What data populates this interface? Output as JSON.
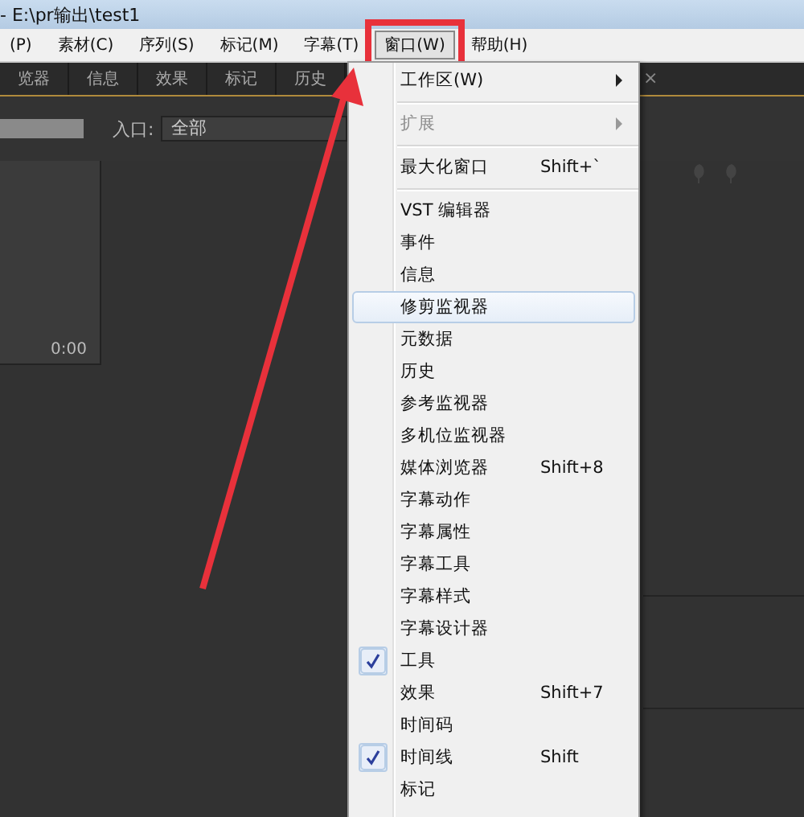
{
  "window": {
    "title": "- E:\\pr输出\\test1"
  },
  "menubar": [
    {
      "label": "(P)",
      "selected": false
    },
    {
      "label": "素材(C)",
      "selected": false
    },
    {
      "label": "序列(S)",
      "selected": false
    },
    {
      "label": "标记(M)",
      "selected": false
    },
    {
      "label": "字幕(T)",
      "selected": false
    },
    {
      "label": "窗口(W)",
      "selected": true
    },
    {
      "label": "帮助(H)",
      "selected": false
    }
  ],
  "panel_tabs": [
    {
      "label": "览器",
      "selected": false
    },
    {
      "label": "信息",
      "selected": false
    },
    {
      "label": "效果",
      "selected": false
    },
    {
      "label": "标记",
      "selected": false
    },
    {
      "label": "历史",
      "selected": false
    }
  ],
  "close_glyph": "×",
  "in_point": {
    "label": "入口:",
    "value": "全部"
  },
  "monitor": {
    "timecode": "0:00"
  },
  "menu": [
    {
      "kind": "submenu",
      "label": "工作区(W)",
      "disabled": false,
      "checked": false,
      "selected": false
    },
    {
      "kind": "separator"
    },
    {
      "kind": "submenu",
      "label": "扩展",
      "disabled": true,
      "checked": false,
      "selected": false
    },
    {
      "kind": "separator"
    },
    {
      "kind": "item",
      "label": "最大化窗口",
      "shortcut": "Shift+`",
      "disabled": false,
      "checked": false,
      "selected": false
    },
    {
      "kind": "separator"
    },
    {
      "kind": "item",
      "label": "VST 编辑器",
      "disabled": false,
      "checked": false,
      "selected": false
    },
    {
      "kind": "item",
      "label": "事件",
      "disabled": false,
      "checked": false,
      "selected": false
    },
    {
      "kind": "item",
      "label": "信息",
      "disabled": false,
      "checked": false,
      "selected": false
    },
    {
      "kind": "item",
      "label": "修剪监视器",
      "disabled": false,
      "checked": false,
      "selected": true
    },
    {
      "kind": "item",
      "label": "元数据",
      "disabled": false,
      "checked": false,
      "selected": false
    },
    {
      "kind": "item",
      "label": "历史",
      "disabled": false,
      "checked": false,
      "selected": false
    },
    {
      "kind": "item",
      "label": "参考监视器",
      "disabled": false,
      "checked": false,
      "selected": false
    },
    {
      "kind": "item",
      "label": "多机位监视器",
      "disabled": false,
      "checked": false,
      "selected": false
    },
    {
      "kind": "item",
      "label": "媒体浏览器",
      "shortcut": "Shift+8",
      "disabled": false,
      "checked": false,
      "selected": false
    },
    {
      "kind": "item",
      "label": "字幕动作",
      "disabled": false,
      "checked": false,
      "selected": false
    },
    {
      "kind": "item",
      "label": "字幕属性",
      "disabled": false,
      "checked": false,
      "selected": false
    },
    {
      "kind": "item",
      "label": "字幕工具",
      "disabled": false,
      "checked": false,
      "selected": false
    },
    {
      "kind": "item",
      "label": "字幕样式",
      "disabled": false,
      "checked": false,
      "selected": false
    },
    {
      "kind": "item",
      "label": "字幕设计器",
      "disabled": false,
      "checked": false,
      "selected": false
    },
    {
      "kind": "item",
      "label": "工具",
      "disabled": false,
      "checked": true,
      "selected": false
    },
    {
      "kind": "item",
      "label": "效果",
      "shortcut": "Shift+7",
      "disabled": false,
      "checked": false,
      "selected": false
    },
    {
      "kind": "item",
      "label": "时间码",
      "disabled": false,
      "checked": false,
      "selected": false
    },
    {
      "kind": "item",
      "label": "时间线",
      "shortcut": "Shift",
      "disabled": false,
      "checked": true,
      "selected": false
    },
    {
      "kind": "item",
      "label": "标记",
      "disabled": false,
      "checked": false,
      "selected": false
    }
  ]
}
